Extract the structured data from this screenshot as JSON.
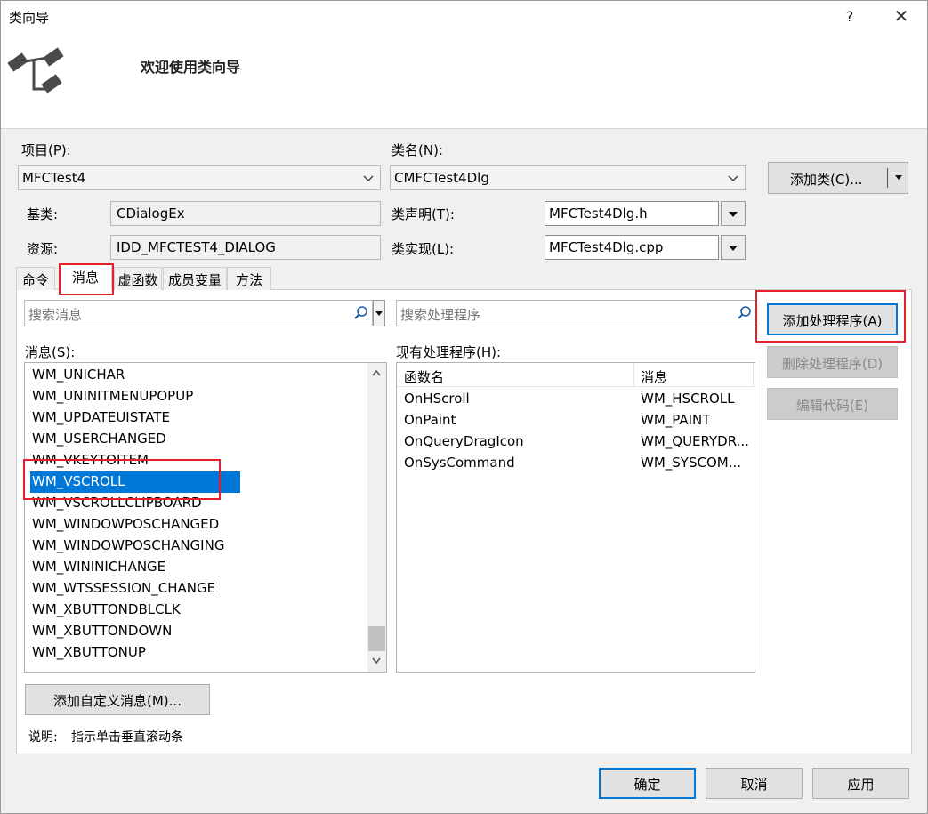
{
  "window": {
    "title": "类向导",
    "help_label": "?",
    "close_label": "✕"
  },
  "banner": {
    "heading": "欢迎使用类向导",
    "icon": "class-wizard-icon"
  },
  "fields": {
    "project_label": "项目(P):",
    "project_value": "MFCTest4",
    "classname_label": "类名(N):",
    "classname_value": "CMFCTest4Dlg",
    "base_label": "基类:",
    "base_value": "CDialogEx",
    "resource_label": "资源:",
    "resource_value": "IDD_MFCTEST4_DIALOG",
    "decl_label": "类声明(T):",
    "decl_value": "MFCTest4Dlg.h",
    "impl_label": "类实现(L):",
    "impl_value": "MFCTest4Dlg.cpp"
  },
  "add_class": {
    "label": "添加类(C)..."
  },
  "tabs": [
    {
      "label": "命令",
      "selected": false
    },
    {
      "label": "消息",
      "selected": true
    },
    {
      "label": "虚函数",
      "selected": false
    },
    {
      "label": "成员变量",
      "selected": false
    },
    {
      "label": "方法",
      "selected": false
    }
  ],
  "messages_search": {
    "placeholder": "搜索消息"
  },
  "handlers_search": {
    "placeholder": "搜索处理程序"
  },
  "messages_label": "消息(S):",
  "messages": [
    "WM_UNICHAR",
    "WM_UNINITMENUPOPUP",
    "WM_UPDATEUISTATE",
    "WM_USERCHANGED",
    "WM_VKEYTOITEM",
    "WM_VSCROLL",
    "WM_VSCROLLCLIPBOARD",
    "WM_WINDOWPOSCHANGED",
    "WM_WINDOWPOSCHANGING",
    "WM_WININICHANGE",
    "WM_WTSSESSION_CHANGE",
    "WM_XBUTTONDBLCLK",
    "WM_XBUTTONDOWN",
    "WM_XBUTTONUP"
  ],
  "selected_message": "WM_VSCROLL",
  "handlers_label": "现有处理程序(H):",
  "handlers_columns": [
    "函数名",
    "消息"
  ],
  "handlers": [
    {
      "func": "OnHScroll",
      "msg": "WM_HSCROLL"
    },
    {
      "func": "OnPaint",
      "msg": "WM_PAINT"
    },
    {
      "func": "OnQueryDragIcon",
      "msg": "WM_QUERYDR..."
    },
    {
      "func": "OnSysCommand",
      "msg": "WM_SYSCOM..."
    }
  ],
  "side_buttons": {
    "add_handler": "添加处理程序(A)",
    "delete_handler": "删除处理程序(D)",
    "edit_code": "编辑代码(E)"
  },
  "add_custom_message": "添加自定义消息(M)...",
  "description": {
    "label": "说明:",
    "text": "指示单击垂直滚动条"
  },
  "footer": {
    "ok": "确定",
    "cancel": "取消",
    "apply": "应用"
  },
  "colors": {
    "selection": "#0078d7",
    "highlight_box": "#e5202b"
  }
}
